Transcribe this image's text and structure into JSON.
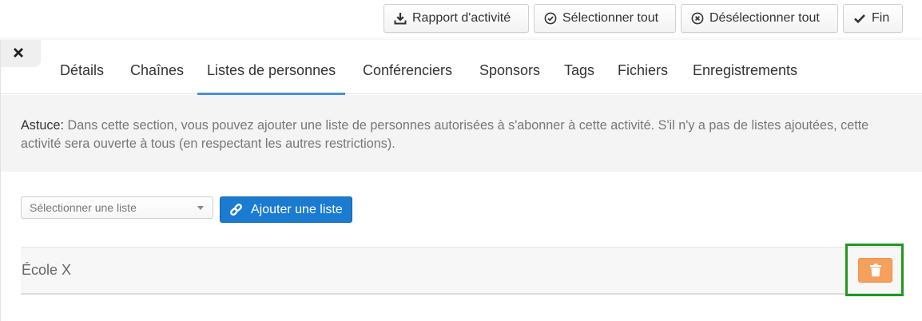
{
  "toolbar": {
    "report_label": "Rapport d'activité",
    "select_all_label": "Sélectionner tout",
    "deselect_all_label": "Désélectionner tout",
    "done_label": "Fin"
  },
  "tabs": [
    {
      "label": "Détails"
    },
    {
      "label": "Chaînes"
    },
    {
      "label": "Listes de personnes",
      "active": true
    },
    {
      "label": "Conférenciers"
    },
    {
      "label": "Sponsors"
    },
    {
      "label": "Tags"
    },
    {
      "label": "Fichiers"
    },
    {
      "label": "Enregistrements"
    }
  ],
  "tip": {
    "label": "Astuce:",
    "text": " Dans cette section, vous pouvez ajouter une liste de personnes autorisées à s'abonner à cette activité. S'il n'y a pas de listes ajoutées, cette activité sera ouverte à tous (en respectant les autres restrictions)."
  },
  "list_select": {
    "placeholder": "Sélectionner une liste"
  },
  "add_list_label": "Ajouter une liste",
  "lists": [
    {
      "name": "École X"
    }
  ],
  "colors": {
    "primary": "#1a7bd0",
    "delete": "#f5a05c",
    "highlight": "#1e9a1e",
    "tab_active": "#4a90d9"
  },
  "icons": {
    "report": "download-icon",
    "select_all": "check-circle-icon",
    "deselect_all": "x-circle-icon",
    "done": "check-icon",
    "close": "close-icon",
    "add": "link-icon",
    "delete": "trash-icon"
  }
}
